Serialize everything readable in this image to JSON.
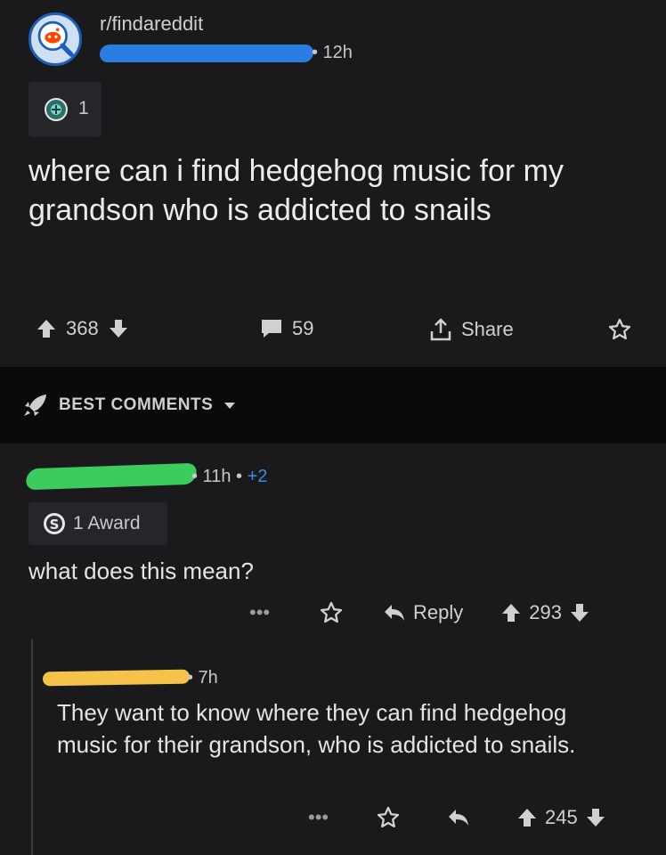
{
  "post": {
    "subreddit": "r/findareddit",
    "age": "• 12h",
    "flair_count": "1",
    "title": "where can i find hedgehog music for my grandson who is addicted to snails",
    "upvotes": "368",
    "comments": "59",
    "share_label": "Share"
  },
  "sort": {
    "label": "BEST COMMENTS"
  },
  "comment1": {
    "meta_time": "• 11h •",
    "meta_score": "+2",
    "award_label": "1 Award",
    "body": "what does this mean?",
    "more": "•••",
    "reply_label": "Reply",
    "score": "293"
  },
  "comment2": {
    "meta_time": "• 7h",
    "body": "They want to know where they can find hedgehog music for their grandson, who is addicted to snails.",
    "more": "•••",
    "score": "245"
  },
  "colors": {
    "background": "#1a1a1c",
    "sort_bar": "#0a0a0b",
    "score_blue": "#3b8be0",
    "redact_blue": "#2a7de1",
    "redact_green": "#3ccc5e",
    "redact_yellow": "#f5c24a"
  },
  "icons": [
    "subreddit-avatar-icon",
    "award-icon",
    "upvote-icon",
    "downvote-icon",
    "comment-icon",
    "share-icon",
    "save-icon",
    "rocket-icon",
    "chevron-down-icon",
    "more-icon",
    "reply-icon",
    "silver-award-icon"
  ]
}
